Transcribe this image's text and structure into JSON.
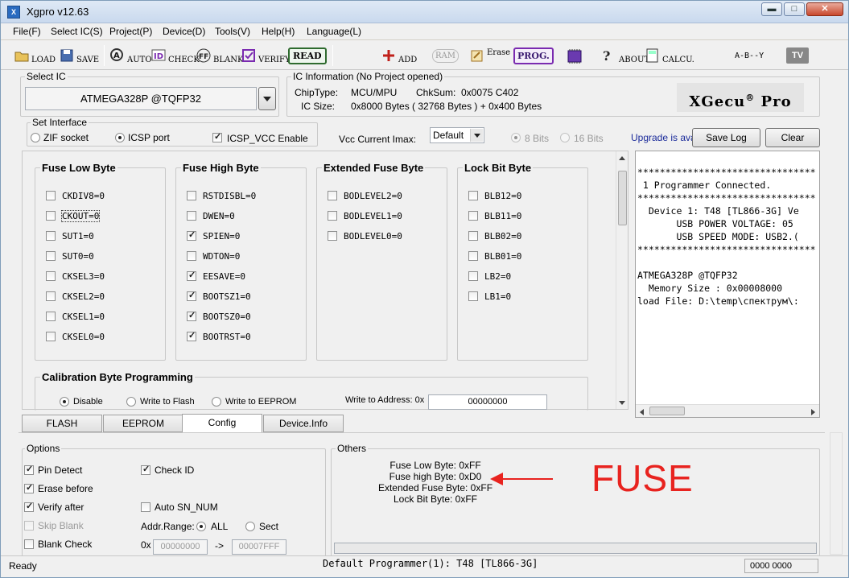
{
  "window": {
    "title": "Xgpro v12.63",
    "controls": {
      "minimize": "▬",
      "maximize": "□",
      "close": "✕"
    }
  },
  "menu": [
    "File(F)",
    "Select IC(S)",
    "Project(P)",
    "Device(D)",
    "Tools(V)",
    "Help(H)",
    "Language(L)"
  ],
  "toolbar": {
    "load": "LOAD",
    "save": "SAVE",
    "auto": "AUTO",
    "check": "CHECK",
    "blank": "BLANK",
    "verify": "VERIFY",
    "read": "READ",
    "add": "ADD",
    "ram": "RAM",
    "erase": "Erase",
    "prog": "PROG.",
    "about": "ABOUT",
    "calcu": "CALCU.",
    "tv": "TV",
    "logic": "A-B--Y"
  },
  "select_ic": {
    "title": "Select IC",
    "value": "ATMEGA328P @TQFP32"
  },
  "ic_info": {
    "title": "IC Information (No Project opened)",
    "chiptype_label": "ChipType:",
    "chiptype": "MCU/MPU",
    "chksum_label": "ChkSum:",
    "chksum": "0x0075 C402",
    "icsize_label": "IC Size:",
    "icsize": "0x8000 Bytes ( 32768 Bytes ) + 0x400 Bytes",
    "logo": "XGecu",
    "logo_reg": "®",
    "logo_pro": "Pro"
  },
  "interface": {
    "title": "Set Interface",
    "zif": "ZIF socket",
    "icsp": "ICSP port",
    "icsp_vcc": "ICSP_VCC Enable",
    "vcc_label": "Vcc Current Imax:",
    "vcc_value": "Default",
    "bits8": "8 Bits",
    "bits16": "16 Bits",
    "upgrade": "Upgrade is ava",
    "save_log": "Save Log",
    "clear": "Clear"
  },
  "fuse_groups": [
    {
      "title": "Fuse Low Byte",
      "items": [
        {
          "label": "CKDIV8=0",
          "checked": false
        },
        {
          "label": "CKOUT=0",
          "checked": false
        },
        {
          "label": "SUT1=0",
          "checked": false
        },
        {
          "label": "SUT0=0",
          "checked": false
        },
        {
          "label": "CKSEL3=0",
          "checked": false
        },
        {
          "label": "CKSEL2=0",
          "checked": false
        },
        {
          "label": "CKSEL1=0",
          "checked": false
        },
        {
          "label": "CKSEL0=0",
          "checked": false
        }
      ]
    },
    {
      "title": "Fuse High Byte",
      "items": [
        {
          "label": "RSTDISBL=0",
          "checked": false
        },
        {
          "label": "DWEN=0",
          "checked": false
        },
        {
          "label": "SPIEN=0",
          "checked": true
        },
        {
          "label": "WDTON=0",
          "checked": false
        },
        {
          "label": "EESAVE=0",
          "checked": true
        },
        {
          "label": "BOOTSZ1=0",
          "checked": true
        },
        {
          "label": "BOOTSZ0=0",
          "checked": true
        },
        {
          "label": "BOOTRST=0",
          "checked": true
        }
      ]
    },
    {
      "title": "Extended Fuse Byte",
      "items": [
        {
          "label": "BODLEVEL2=0",
          "checked": false
        },
        {
          "label": "BODLEVEL1=0",
          "checked": false
        },
        {
          "label": "BODLEVEL0=0",
          "checked": false
        }
      ]
    },
    {
      "title": "Lock Bit Byte",
      "items": [
        {
          "label": "BLB12=0",
          "checked": false
        },
        {
          "label": "BLB11=0",
          "checked": false
        },
        {
          "label": "BLB02=0",
          "checked": false
        },
        {
          "label": "BLB01=0",
          "checked": false
        },
        {
          "label": "LB2=0",
          "checked": false
        },
        {
          "label": "LB1=0",
          "checked": false
        }
      ]
    }
  ],
  "calibration": {
    "title": "Calibration Byte Programming",
    "disable": "Disable",
    "write_flash": "Write to Flash",
    "write_eeprom": "Write to EEPROM",
    "address_label": "Write to Address: 0x",
    "address": "00000000"
  },
  "log": {
    "lines": [
      "********************************",
      " 1 Programmer Connected.",
      "********************************",
      "  Device 1: T48 [TL866-3G] Ve",
      "       USB POWER VOLTAGE: 05",
      "       USB SPEED MODE: USB2.(",
      "********************************",
      "",
      "ATMEGA328P @TQFP32",
      "  Memory Size : 0x00008000",
      "load File: D:\\temp\\спектрум\\:"
    ]
  },
  "tabs": [
    "FLASH",
    "EEPROM",
    "Config",
    "Device.Info"
  ],
  "options": {
    "title": "Options",
    "pin_detect": "Pin Detect",
    "check_id": "Check ID",
    "erase_before": "Erase before",
    "verify_after": "Verify after",
    "auto_sn": "Auto SN_NUM",
    "skip_blank": "Skip Blank",
    "addr_range": "Addr.Range:",
    "all": "ALL",
    "sect": "Sect",
    "blank_check": "Blank Check",
    "ox": "0x",
    "from": "00000000",
    "arrow": "->",
    "to": "00007FFF"
  },
  "others": {
    "title": "Others",
    "fuse_low": "Fuse Low Byte: 0xFF",
    "fuse_high": "Fuse high Byte: 0xD0",
    "ext_fuse": "Extended Fuse Byte: 0xFF",
    "lock_bit": "Lock Bit Byte: 0xFF",
    "annotation": "FUSE",
    "annotation_color": "#e8231f"
  },
  "status": {
    "left": "Ready",
    "center": "Default Programmer(1): T48 [TL866-3G]",
    "right": "0000 0000"
  }
}
